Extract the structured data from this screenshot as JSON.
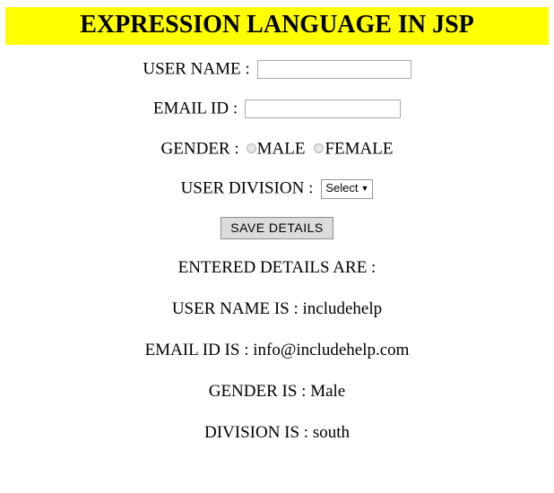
{
  "header": {
    "title": "EXPRESSION LANGUAGE IN JSP",
    "background_color": "#ffff00",
    "text_color": "#000000"
  },
  "form": {
    "username": {
      "label": "USER NAME :",
      "value": "",
      "placeholder": ""
    },
    "email": {
      "label": "EMAIL ID :",
      "value": "",
      "placeholder": ""
    },
    "gender": {
      "label": "GENDER :",
      "options": [
        {
          "label": "MALE",
          "checked": false
        },
        {
          "label": "FEMALE",
          "checked": false
        }
      ]
    },
    "division": {
      "label": "USER DIVISION :",
      "selected": "Select",
      "caret": "▼"
    },
    "submit": {
      "label": "SAVE DETAILS"
    }
  },
  "results": {
    "heading": "ENTERED DETAILS ARE :",
    "lines": [
      "USER NAME IS : includehelp",
      "EMAIL ID IS : info@includehelp.com",
      "GENDER IS : Male",
      "DIVISION IS : south"
    ]
  }
}
